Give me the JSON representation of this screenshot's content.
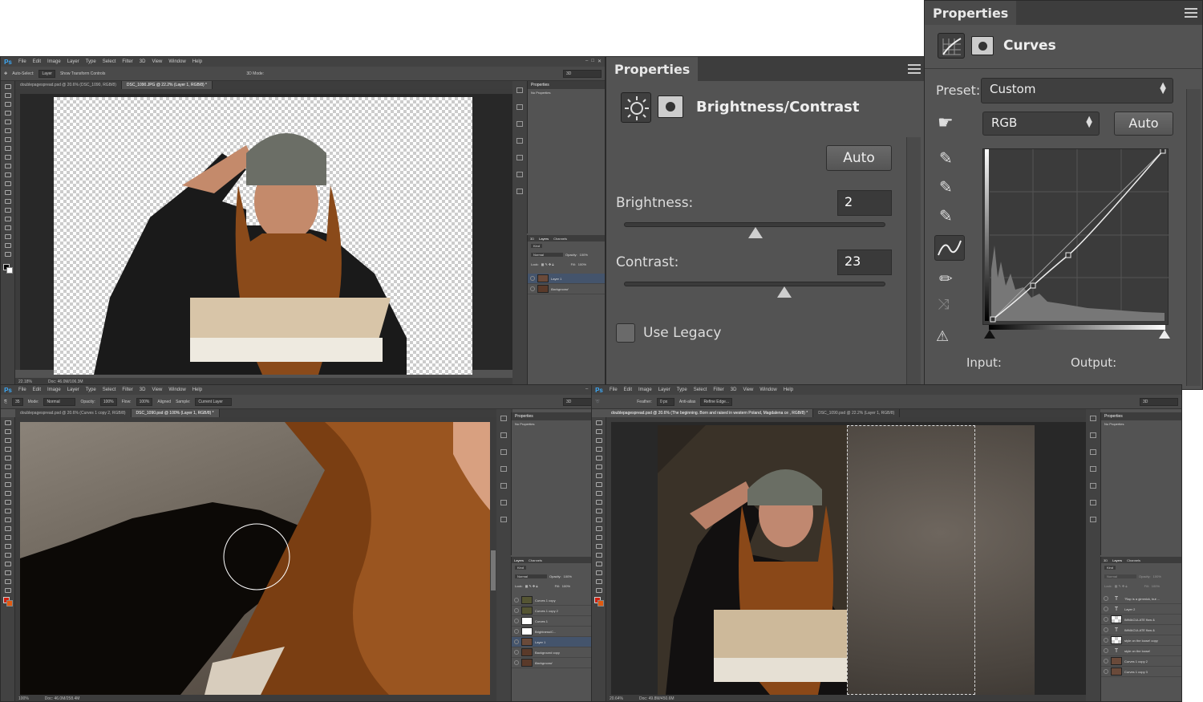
{
  "window_top_left": {
    "menu": [
      "File",
      "Edit",
      "Image",
      "Layer",
      "Type",
      "Select",
      "Filter",
      "3D",
      "View",
      "Window",
      "Help"
    ],
    "logo": "Ps",
    "options": {
      "auto_select": "Auto-Select:",
      "auto_select_value": "Layer",
      "show_transform": "Show Transform Controls",
      "mode_3d": "3D Mode:",
      "workspace": "3D"
    },
    "tabs": [
      "doublepagespread.psd @ 20.6% (DSC_1090, RGB/8)",
      "DSC_1090.JPG @ 22.2% (Layer 1, RGB/8) *"
    ],
    "status_zoom": "22.18%",
    "status_doc": "Doc: 46.0M/106.3M",
    "properties_title": "Properties",
    "properties_sub": "No Properties",
    "layers_tabs": [
      "3D",
      "Layers",
      "Channels"
    ],
    "layers_kind": "Kind",
    "layers_blend": "Normal",
    "layers_opacity_label": "Opacity:",
    "layers_opacity": "100%",
    "layers_lock": "Lock:",
    "layers_fill_label": "Fill:",
    "layers_fill": "100%",
    "layers": [
      {
        "name": "Layer 1",
        "selected": true
      },
      {
        "name": "Background",
        "selected": false
      }
    ]
  },
  "brightness_panel": {
    "title": "Properties",
    "heading": "Brightness/Contrast",
    "auto": "Auto",
    "brightness_label": "Brightness:",
    "brightness_value": "2",
    "brightness_slider": 0.5,
    "contrast_label": "Contrast:",
    "contrast_value": "23",
    "contrast_slider": 0.6,
    "use_legacy": "Use Legacy"
  },
  "curves_panel": {
    "title": "Properties",
    "heading": "Curves",
    "preset_label": "Preset:",
    "preset_value": "Custom",
    "channel": "RGB",
    "auto": "Auto",
    "input_label": "Input:",
    "output_label": "Output:"
  },
  "window_bottom_left": {
    "menu": [
      "File",
      "Edit",
      "Image",
      "Layer",
      "Type",
      "Select",
      "Filter",
      "3D",
      "View",
      "Window",
      "Help"
    ],
    "logo": "Ps",
    "options": {
      "brush": "35",
      "mode_label": "Mode:",
      "mode": "Normal",
      "opacity_label": "Opacity:",
      "opacity": "100%",
      "flow_label": "Flow:",
      "flow": "100%",
      "aligned": "Aligned",
      "sample_label": "Sample:",
      "sample": "Current Layer",
      "workspace": "3D"
    },
    "tabs": [
      "doublepagespread.psd @ 20.6% (Curves 1 copy 2, RGB/8)",
      "DSC_1090.psd @ 100% (Layer 1, RGB/8) *"
    ],
    "status_zoom": "100%",
    "status_doc": "Doc: 46.0M/258.4M",
    "properties_title": "Properties",
    "properties_sub": "No Properties",
    "layers_tabs": [
      "Layers",
      "Channels"
    ],
    "layers_kind": "Kind",
    "layers_blend": "Normal",
    "layers_opacity_label": "Opacity:",
    "layers_opacity": "100%",
    "layers_lock": "Lock:",
    "layers_fill_label": "Fill:",
    "layers_fill": "100%",
    "layers": [
      {
        "name": "Curves 1 copy",
        "selected": false
      },
      {
        "name": "Curves 1 copy 2",
        "selected": false
      },
      {
        "name": "Curves 1",
        "selected": false
      },
      {
        "name": "Brightness/C...",
        "selected": false
      },
      {
        "name": "Layer 1",
        "selected": true
      },
      {
        "name": "Background copy",
        "selected": false
      },
      {
        "name": "Background",
        "selected": false
      }
    ]
  },
  "window_bottom_right": {
    "menu": [
      "File",
      "Edit",
      "Image",
      "Layer",
      "Type",
      "Select",
      "Filter",
      "3D",
      "View",
      "Window",
      "Help"
    ],
    "logo": "Ps",
    "options": {
      "feather_label": "Feather:",
      "feather": "0 px",
      "anti_alias": "Anti-alias",
      "refine": "Refine Edge...",
      "workspace": "3D"
    },
    "tabs": [
      "doublepagespread.psd @ 20.6% (The beginning. Born and raised in western Poland, Magdalena ce , RGB/8) *",
      "DSC_1090.psd @ 22.2% (Layer 1, RGB/8)"
    ],
    "status_zoom": "20.64%",
    "status_doc": "Doc: 49.8M/450.6M",
    "properties_title": "Properties",
    "properties_sub": "No Properties",
    "layers_tabs": [
      "3D",
      "Layers",
      "Channels"
    ],
    "layers_kind": "Kind",
    "layers_blend": "Normal",
    "layers_opacity_label": "Opacity:",
    "layers_opacity": "100%",
    "layers_lock": "Lock:",
    "layers_fill_label": "Fill:",
    "layers_fill": "100%",
    "layers": [
      {
        "name": "\"Rap is a gimmick, but ...",
        "selected": false
      },
      {
        "name": "Layer 2",
        "selected": false
      },
      {
        "name": "IMMACULATE flow &",
        "selected": false
      },
      {
        "name": "IMMACULATE flow &",
        "selected": false
      },
      {
        "name": "style on the loose! copy",
        "selected": false
      },
      {
        "name": "style on the loose!",
        "selected": false
      },
      {
        "name": "Curves 1 copy 2",
        "selected": false
      },
      {
        "name": "Curves 1 copy 3",
        "selected": false
      }
    ]
  },
  "colors": {
    "ps_bg": "#535353",
    "ps_dark": "#282828",
    "accent": "#3da8f5",
    "selection": "#44546c"
  }
}
